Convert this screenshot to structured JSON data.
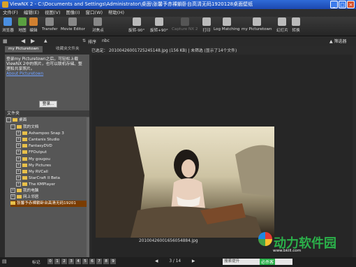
{
  "window": {
    "title": "ViewNX 2 - C:\\Documents and Settings\\Administrator\\桌面\\张馨予赤裸躺卧台高清无码1920128桌面壁纸"
  },
  "menu": [
    "文件(F)",
    "编辑(E)",
    "视图(V)",
    "图像(I)",
    "窗口(W)",
    "帮助(H)"
  ],
  "toolbar": [
    {
      "label": "浏览器",
      "icon": "browser-icon",
      "color": "#4a8fe0"
    },
    {
      "label": "地图",
      "icon": "map-icon",
      "color": "#5aa040"
    },
    {
      "label": "编辑",
      "icon": "edit-icon",
      "color": "#d08030"
    },
    {
      "label": "Transfer",
      "icon": "transfer-icon",
      "color": "#888"
    },
    {
      "label": "Movie Editor",
      "icon": "movie-editor-icon",
      "color": "#888"
    },
    {
      "label": "对焦点",
      "icon": "focus-point-icon",
      "color": "#888"
    },
    {
      "label": "旋转-90°",
      "icon": "rotate-left-icon",
      "color": "#bbb"
    },
    {
      "label": "旋转+90°",
      "icon": "rotate-right-icon",
      "color": "#bbb"
    },
    {
      "label": "Capture NX 2",
      "icon": "capture-nx-icon",
      "color": "#555"
    },
    {
      "label": "打印",
      "icon": "print-icon",
      "color": "#bbb"
    },
    {
      "label": "Log Matching",
      "icon": "log-matching-icon",
      "color": "#bbb"
    },
    {
      "label": "my Picturetown",
      "icon": "picturetown-icon",
      "color": "#bbb"
    },
    {
      "label": "幻灯片",
      "icon": "slideshow-icon",
      "color": "#bbb"
    },
    {
      "label": "转换",
      "icon": "convert-icon",
      "color": "#bbb"
    }
  ],
  "tabs": {
    "active": "my Picturetown",
    "inactive": "收藏夹文件夹"
  },
  "nav": {
    "sort_label": "排序",
    "sort_value": "nbc",
    "filter_label": "筛选器"
  },
  "picturetown": {
    "text": "登录my Picturetown之后，可轻松上载ViewNX 2中的照片，也可以联机存储、整理和共享照片。",
    "link": "About Picturetown",
    "login_button": "登录..."
  },
  "folders": {
    "header": "文件夹",
    "items": [
      "桌面",
      "我的文档",
      "Ashampoo Snap 3",
      "Cantanis Studio",
      "FantasyDVD",
      "FFOutput",
      "My gougou",
      "My Pictures",
      "My RVCall",
      "StarCraft II Beta",
      "The KMPlayer",
      "我的电脑",
      "网上邻居",
      "张馨予赤裸躺卧台高清无码19201"
    ]
  },
  "info": {
    "selected": "已选定：",
    "filename": "20100426001725245148.jpg (156 KB) | 未筛选 (显示了14个文件)"
  },
  "photo": {
    "caption": "20100426001656054884.jpg"
  },
  "status": {
    "label_text": "标记",
    "ratings": [
      "0",
      "1",
      "2",
      "3",
      "4",
      "5",
      "6",
      "7",
      "8",
      "9"
    ],
    "pager": "3 / 14",
    "search_placeholder": "搜索提升"
  },
  "watermark": {
    "text": "动力软件园",
    "url": "www.bkill.com",
    "tag": "必杀客"
  }
}
